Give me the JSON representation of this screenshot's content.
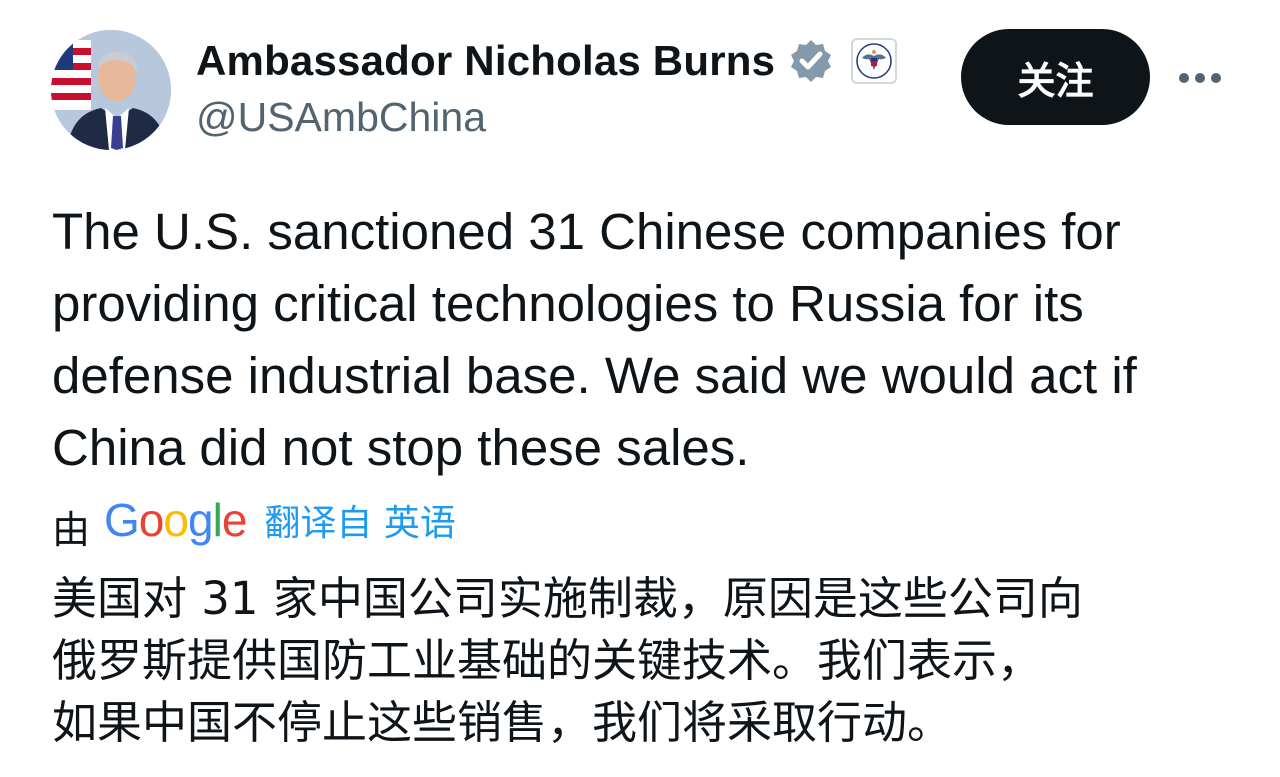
{
  "author": {
    "display_name": "Ambassador Nicholas Burns",
    "handle": "@USAmbChina",
    "verified": true
  },
  "follow_button": {
    "label": "关注"
  },
  "tweet": {
    "text_lines": [
      "The U.S. sanctioned 31 Chinese companies for",
      "providing critical technologies to Russia for its",
      "defense industrial base. We said we would act if",
      "China did not stop these sales."
    ]
  },
  "translation": {
    "by_label": "由",
    "provider_letters": [
      "G",
      "o",
      "o",
      "g",
      "l",
      "e"
    ],
    "provider_colors": [
      "#4285F4",
      "#EA4335",
      "#FBBC05",
      "#4285F4",
      "#34A853",
      "#EA4335"
    ],
    "source_label": "翻译自 英语",
    "text_lines": [
      "美国对 31 家中国公司实施制裁，原因是这些公司向",
      "俄罗斯提供国防工业基础的关键技术。我们表示，",
      "如果中国不停止这些销售，我们将采取行动。"
    ]
  },
  "colors": {
    "text_primary": "#0f1419",
    "text_secondary": "#536471",
    "link": "#1d9bf0",
    "verified_badge": "#829aab",
    "follow_bg": "#0f1419"
  },
  "icons": {
    "verified": "verified-badge-icon",
    "affiliation": "us-state-department-seal-icon",
    "more": "more-options-icon"
  }
}
